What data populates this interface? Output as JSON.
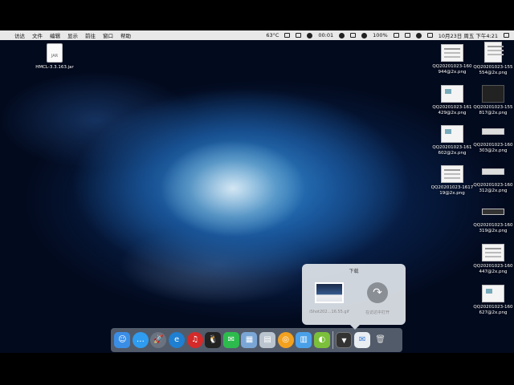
{
  "menubar": {
    "apple": "",
    "items": [
      "访达",
      "文件",
      "编辑",
      "显示",
      "前往",
      "窗口",
      "帮助"
    ],
    "status": {
      "temp": "63°C",
      "timer": "00:01",
      "battery": "100%",
      "datetime": "10月23日 周五 下午4:21"
    }
  },
  "desktop": {
    "jar": {
      "label": "HMCL-3.3.163.jar"
    },
    "files_col1": [
      {
        "name": "QQ20201023-160\n944@2x.png"
      },
      {
        "name": "QQ20201023-161\n429@2x.png"
      },
      {
        "name": "QQ20201023-161\n602@2x.png"
      },
      {
        "name": "QQ20201023-1617\n19@2x.png"
      }
    ],
    "files_col2": [
      {
        "name": "QQ20201023-155\n554@2x.png"
      },
      {
        "name": "QQ20201023-155\n817@2x.png"
      },
      {
        "name": "QQ20201023-160\n303@2x.png"
      },
      {
        "name": "QQ20201023-160\n312@2x.png"
      },
      {
        "name": "QQ20201023-160\n319@2x.png"
      },
      {
        "name": "QQ20201023-160\n447@2x.png"
      },
      {
        "name": "QQ20201023-160\n627@2x.png"
      }
    ]
  },
  "downloads_stack": {
    "title": "下载",
    "file_label": "iShot202…16.55.gif",
    "open_label": "在访达中打开"
  },
  "dock": {
    "apps": [
      {
        "name": "finder",
        "glyph": "☺",
        "color": "#3a8ee6"
      },
      {
        "name": "messages",
        "glyph": "…",
        "color": "#2f9cf0"
      },
      {
        "name": "launchpad",
        "glyph": "🚀",
        "color": "#6b7380"
      },
      {
        "name": "edge",
        "glyph": "e",
        "color": "#1f7fd1"
      },
      {
        "name": "netease-music",
        "glyph": "♫",
        "color": "#d42a2a"
      },
      {
        "name": "qq",
        "glyph": "🐧",
        "color": "#222222"
      },
      {
        "name": "wechat",
        "glyph": "✉",
        "color": "#2dbb4e"
      },
      {
        "name": "preview",
        "glyph": "▦",
        "color": "#7aa6d6"
      },
      {
        "name": "image-viewer",
        "glyph": "▤",
        "color": "#b9c4cf"
      },
      {
        "name": "software-update",
        "glyph": "◎",
        "color": "#f2a11f"
      },
      {
        "name": "gift-app",
        "glyph": "▥",
        "color": "#4aa0e8"
      },
      {
        "name": "android-file-transfer",
        "glyph": "◐",
        "color": "#7bbf3a"
      }
    ],
    "downloads_glyph": "▼",
    "mail_glyph": "✉",
    "trash_glyph": "🗑"
  }
}
